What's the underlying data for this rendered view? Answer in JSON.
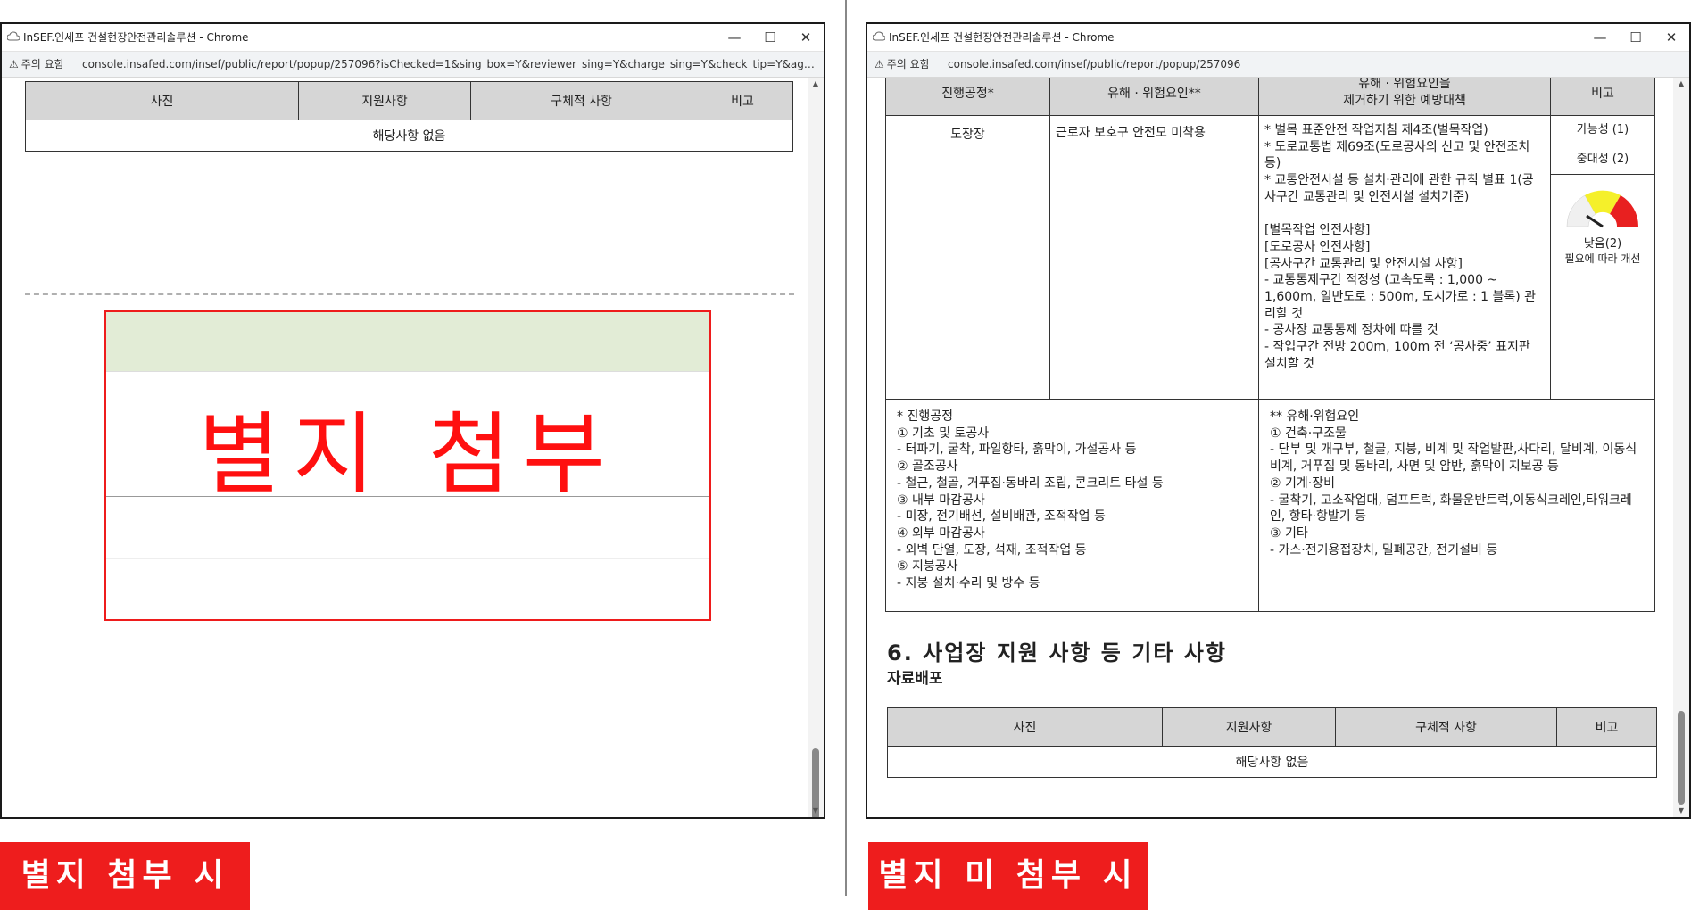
{
  "left": {
    "window_title": "InSEF.인세프 건설현장안전관리솔루션 - Chrome",
    "warning": "주의 요함",
    "url": "console.insafed.com/insef/public/report/popup/257096?isChecked=1&sing_box=Y&reviewer_sing=Y&charge_sing=Y&check_tip=Y&agent_...",
    "table_headers": [
      "사진",
      "지원사항",
      "구체적 사항",
      "비고"
    ],
    "empty_text": "해당사항 없음",
    "stamp_text": "별지 첨부"
  },
  "right": {
    "window_title": "InSEF.인세프 건설현장안전관리솔루션 - Chrome",
    "warning": "주의 요함",
    "url": "console.insafed.com/insef/public/report/popup/257096",
    "risk_headers": {
      "process": "진행공정*",
      "hazard": "유해 · 위험요인**",
      "measures": "유해 · 위험요인을\n제거하기 위한 예방대책",
      "note": "비고"
    },
    "risk_row": {
      "process": "도장장",
      "hazard": "근로자 보호구 안전모 미착용",
      "measures": "* 벌목 표준안전 작업지침 제4조(벌목작업)\n* 도로교통법 제69조(도로공사의 신고 및 안전조치 등)\n* 교통안전시설 등 설치·관리에 관한 규칙 별표 1(공사구간 교통관리 및 안전시설 설치기준)\n\n[벌목작업 안전사항]\n[도로공사 안전사항]\n[공사구간 교통관리 및 안전시설 사항]\n- 교통통제구간 적정성 (고속도록 : 1,000 ~ 1,600m, 일반도로 : 500m, 도시가로 : 1 블록) 관리할 것\n- 공사장 교통통제 정차에 따를 것\n- 작업구간 전방 200m, 100m 전 ‘공사중’ 표지판 설치할 것",
      "possibility": "가능성 (1)",
      "severity": "중대성 (2)",
      "gauge_label": "낮음(2)",
      "gauge_note": "필요에 따라 개선"
    },
    "footnote_left": "* 진행공정\n① 기초 및 토공사\n- 터파기, 굴착, 파일항타, 흙막이, 가설공사 등\n② 골조공사\n- 철근, 철골, 거푸집·동바리 조립, 콘크리트 타설 등\n③ 내부 마감공사\n- 미장, 전기배선, 설비배관, 조적작업 등\n④ 외부 마감공사\n- 외벽 단열, 도장, 석재, 조적작업 등\n⑤ 지붕공사\n- 지붕 설치·수리 및 방수 등",
    "footnote_right": "** 유해·위험요인\n① 건축·구조물\n- 단부 및 개구부, 철골, 지붕, 비계 및 작업발판,사다리, 달비계, 이동식비계, 거푸집 및 동바리, 사면 및 암반, 흙막이 지보공 등\n② 기계·장비\n- 굴착기, 고소작업대, 덤프트럭, 화물운반트럭,이동식크레인,타워크레인, 항타·항발기 등\n③ 기타\n- 가스·전기용접장치, 밀폐공간, 전기설비 등",
    "section_title": "6. 사업장 지원 사항 등 기타 사항",
    "sub_title": "자료배포",
    "table_headers": [
      "사진",
      "지원사항",
      "구체적 사항",
      "비고"
    ],
    "empty_text": "해당사항 없음"
  },
  "labels": {
    "left": "별지 첨부 시",
    "right": "별지 미 첨부 시"
  },
  "colors": {
    "accent_red": "#ee1d1d",
    "stamp_red": "#ff1010",
    "header_gray": "#d6d6d6",
    "green_row": "#e2ecd6"
  }
}
